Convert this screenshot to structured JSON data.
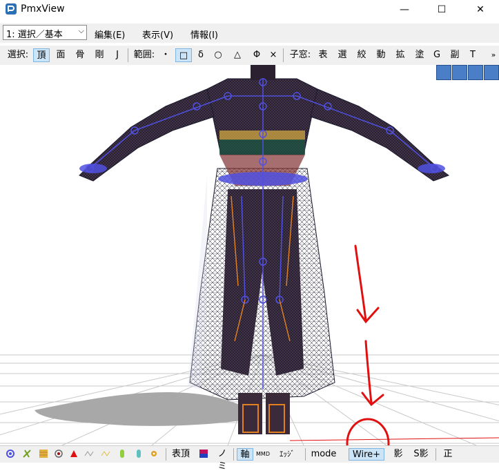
{
  "window": {
    "title": "PmxView",
    "minimize_glyph": "—",
    "maximize_glyph": "☐",
    "close_glyph": "✕"
  },
  "menubar": {
    "mode_value": "1: 選択／基本",
    "edit": "編集(E)",
    "view": "表示(V)",
    "info": "情報(I)"
  },
  "toolbar": {
    "select_label": "選択:",
    "select_items": [
      "頂",
      "面",
      "骨",
      "剛",
      "J"
    ],
    "range_label": "範囲:",
    "range_items": [
      "・",
      "□",
      "δ",
      "○",
      "△",
      "Φ",
      "×"
    ],
    "child_label": "子窓:",
    "child_items": [
      "表",
      "選",
      "絞",
      "動",
      "拡",
      "塗",
      "G",
      "副",
      "T"
    ],
    "overflow": "»"
  },
  "statusbar": {
    "table_vertex": "表頂",
    "nomi": "ノミ",
    "axis": "軸",
    "mmd": "MMD",
    "edge": "ｴｯｼﾞ",
    "mode": "mode",
    "wire": "Wire+",
    "shadow": "影",
    "s_shadow": "S影",
    "front": "正"
  },
  "colors": {
    "wire": "#1a1a2e",
    "bone": "#5050e0",
    "annotation": "#e01010",
    "grid": "#c8c8c8",
    "shadow": "#a8a8a8"
  }
}
